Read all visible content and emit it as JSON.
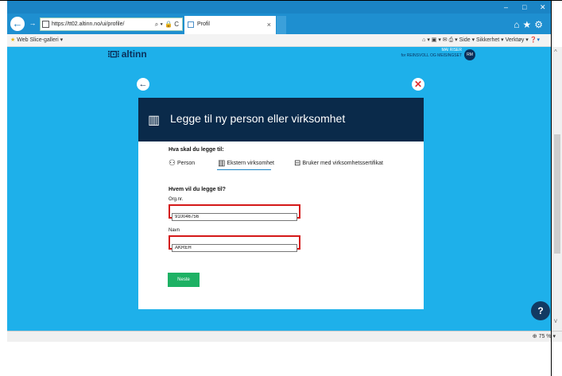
{
  "browser": {
    "url": "https://tt02.altinn.no/ui/profile/",
    "tab_title": "Profil",
    "tab_close": "×",
    "favorites_item": "Web Slice-galleri ▾",
    "command_menus": "Side ▾  Sikkerhet ▾  Verktøy ▾",
    "window_min": "–",
    "window_max": "□",
    "window_close": "✕",
    "zoom": "75 %"
  },
  "header": {
    "logo_text": "altinn",
    "user_name": "MAI RISER",
    "user_org": "for REINSVOLL OG MEISINGSET",
    "avatar_initials": "RM"
  },
  "dialog": {
    "title": "Legge til ny person eller virksomhet",
    "question1": "Hva skal du legge til:",
    "options": [
      {
        "label": "Person",
        "icon": "person-icon"
      },
      {
        "label": "Ekstern virksomhet",
        "icon": "building-icon"
      },
      {
        "label": "Bruker med virksomhetssertifikat",
        "icon": "certificate-icon"
      }
    ],
    "selected_option": "Ekstern virksomhet",
    "question2": "Hvem vil du legge til?",
    "orgnr_label": "Org.nr.",
    "orgnr_value": "910046756",
    "name_label": "Navn",
    "name_value": "ÅKREH",
    "next_label": "Neste"
  },
  "help_label": "?",
  "colors": {
    "page_bg": "#1eb0ea",
    "header_dark": "#0a2a4a",
    "highlight": "#d41818",
    "next_button": "#1eb164"
  }
}
